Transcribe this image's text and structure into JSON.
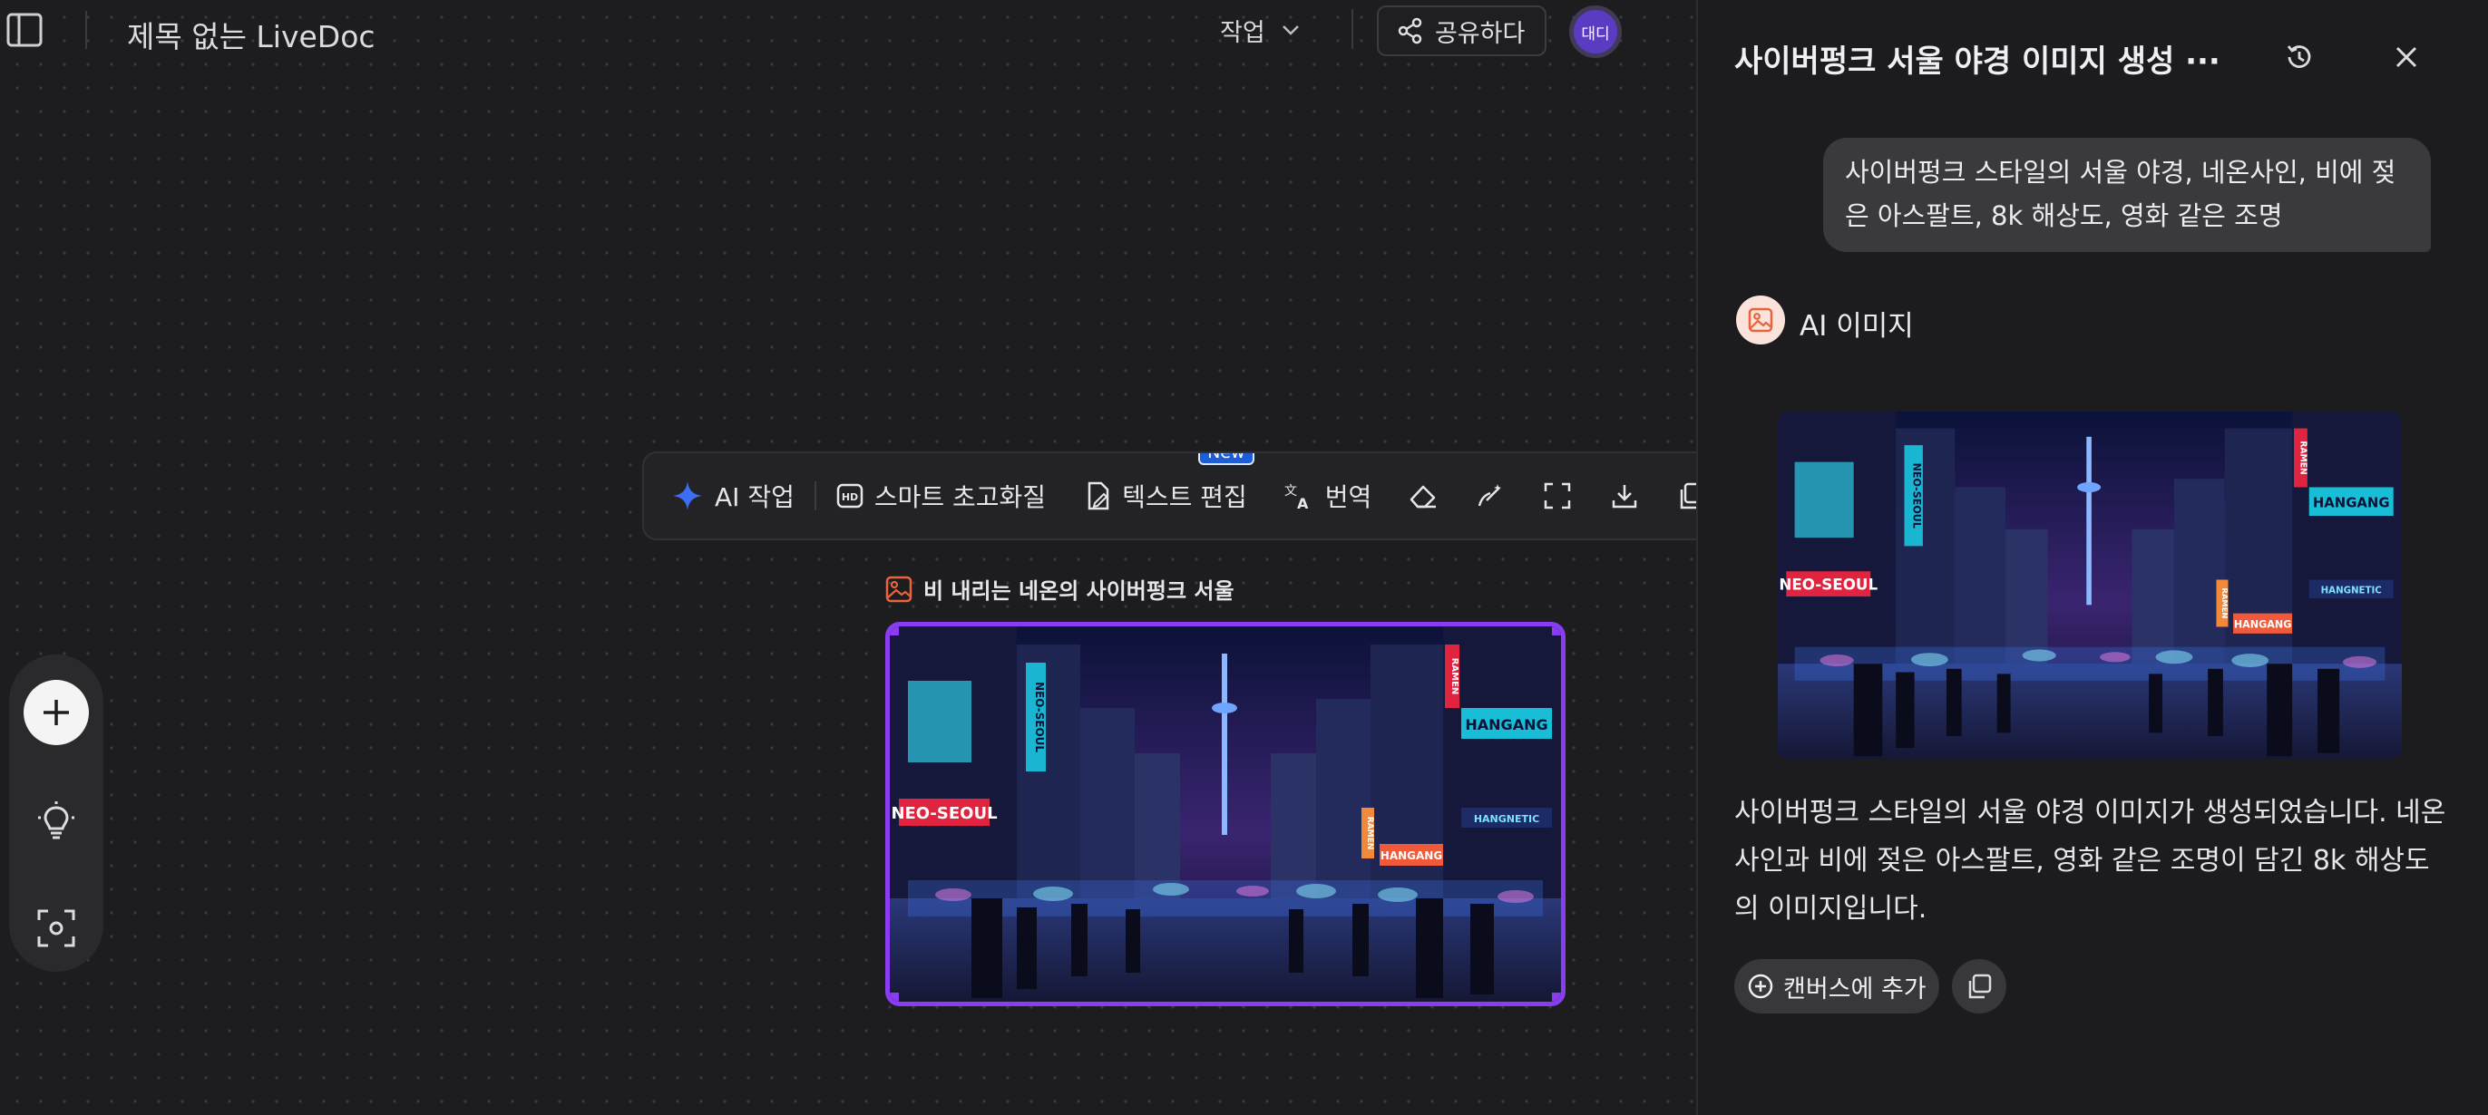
{
  "header": {
    "doc_title": "제목 없는 LiveDoc",
    "work_label": "작업",
    "share_label": "공유하다",
    "avatar_text": "대디"
  },
  "toolbar": {
    "ai_action": "AI 작업",
    "smart_upscale": "스마트 초고화질",
    "text_edit": "텍스트 편집",
    "new_badge": "New",
    "translate": "번역"
  },
  "canvas": {
    "image_label": "비 내리는 네온의 사이버펑크 서울"
  },
  "panel": {
    "title": "사이버펑크 서울 야경 이미지 생성 ···",
    "user_message": "사이버펑크 스타일의 서울 야경, 네온사인, 비에 젖은 아스팔트, 8k 해상도, 영화 같은 조명",
    "ai_label": "AI 이미지",
    "ai_response": "사이버펑크 스타일의 서울 야경 이미지가 생성되었습니다. 네온사인과 비에 젖은 아스팔트, 영화 같은 조명이 담긴 8k 해상도의 이미지입니다.",
    "add_to_canvas": "캔버스에 추가"
  },
  "image_signage": {
    "left_sign": "NEO-SEOUL",
    "vertical_sign": "NEO-SEOUL",
    "right_sign": "HANGANG",
    "right_sign2": "HANGANG",
    "right_sign3": "HANGNETIC",
    "ramen_sign": "RAMEN",
    "ramen_sign2": "RAMEN"
  },
  "colors": {
    "accent_purple": "#8a3cf0",
    "ai_star_blue": "#3d6cf5",
    "new_badge_blue": "#1e5dd8",
    "image_icon_orange": "#e8643c"
  }
}
